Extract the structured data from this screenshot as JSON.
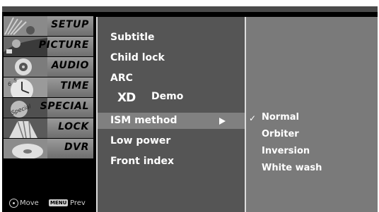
{
  "sidebar": {
    "items": [
      {
        "label": "SETUP",
        "icon": "setup-icon"
      },
      {
        "label": "PICTURE",
        "icon": "picture-icon"
      },
      {
        "label": "AUDIO",
        "icon": "audio-icon"
      },
      {
        "label": "TIME",
        "icon": "clock-icon"
      },
      {
        "label": "SPECIAL",
        "icon": "special-icon"
      },
      {
        "label": "LOCK",
        "icon": "lock-icon"
      },
      {
        "label": "DVR",
        "icon": "dvr-icon"
      }
    ],
    "footer": {
      "move_label": "Move",
      "menu_badge": "MENU",
      "prev_label": "Prev"
    }
  },
  "main": {
    "items": [
      "Subtitle",
      "Child lock",
      "ARC",
      "Demo",
      "ISM method",
      "Low power",
      "Front index"
    ],
    "xd_logo_text": "XD"
  },
  "submenu": {
    "check_mark": "✓",
    "items": [
      "Normal",
      "Orbiter",
      "Inversion",
      "White wash"
    ],
    "selected": "Normal"
  },
  "colors": {
    "osd_background": "#000000",
    "panel_main": "#555555",
    "panel_sub": "#7a7a7a",
    "highlight": "#808080",
    "text": "#ffffff"
  }
}
